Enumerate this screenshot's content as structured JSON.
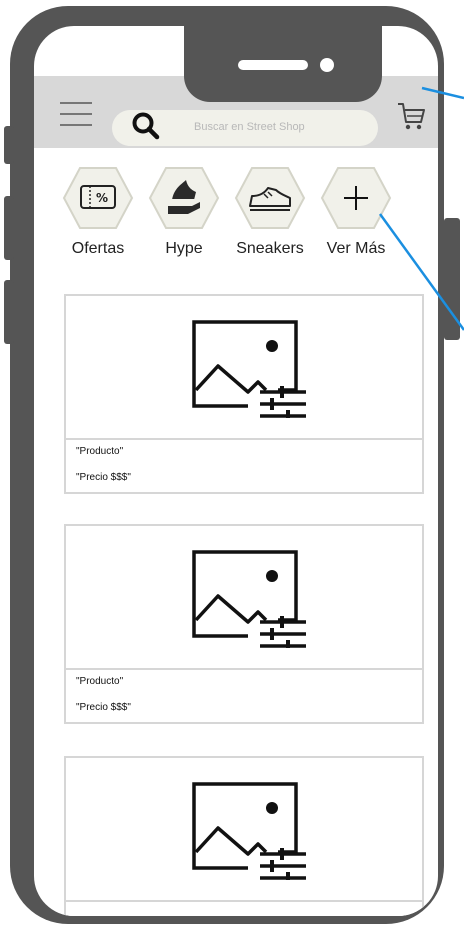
{
  "header": {
    "search_placeholder": "Buscar en Street Shop",
    "icons": [
      "menu-icon",
      "search-icon",
      "cart-icon"
    ]
  },
  "categories": [
    {
      "label": "Ofertas",
      "icon": "ticket-percent-icon"
    },
    {
      "label": "Hype",
      "icon": "hype-hand-icon"
    },
    {
      "label": "Sneakers",
      "icon": "sneaker-icon"
    },
    {
      "label": "Ver Más",
      "icon": "plus-icon"
    }
  ],
  "products": [
    {
      "name": "\"Producto\"",
      "price": "\"Precio $$$\""
    },
    {
      "name": "\"Producto\"",
      "price": "\"Precio $$$\""
    },
    {
      "name": "",
      "price": ""
    }
  ],
  "colors": {
    "phone_frame": "#555555",
    "header_bg": "#d8d8d8",
    "annotation_line": "#1b8fe0"
  }
}
